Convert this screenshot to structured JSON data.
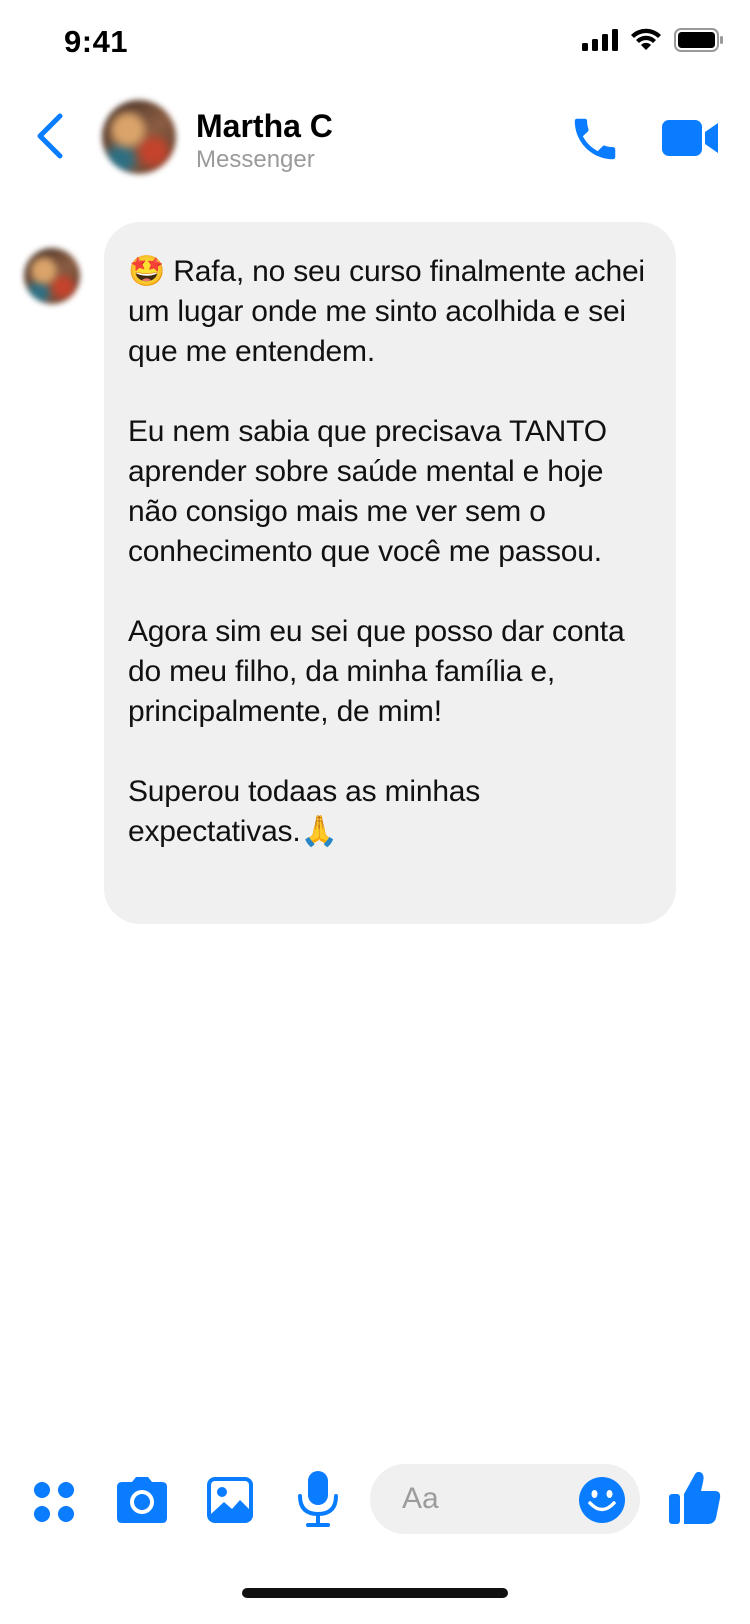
{
  "status_bar": {
    "time": "9:41"
  },
  "header": {
    "contact_name": "Martha C",
    "subtitle": "Messenger"
  },
  "message": {
    "paragraphs": [
      {
        "emoji": "🤩",
        "text": " Rafa, no seu curso finalmente achei um lugar onde me sinto acolhida e sei que me entendem."
      },
      {
        "emoji": "",
        "text": "Eu nem sabia que precisava TANTO aprender sobre saúde mental e hoje não consigo mais me ver sem o conhecimento que você me passou."
      },
      {
        "emoji": "",
        "text": "Agora sim eu sei que posso dar conta do meu filho, da minha família e, principalmente, de mim!"
      },
      {
        "emoji": "🙏",
        "text": "Superou todaas as minhas expectativas."
      }
    ]
  },
  "composer": {
    "placeholder": "Aa"
  },
  "icons": {
    "back": "chevron-left-icon",
    "call": "phone-icon",
    "video": "video-camera-icon",
    "apps": "four-dots-icon",
    "camera": "camera-icon",
    "gallery": "image-icon",
    "mic": "microphone-icon",
    "emoji": "smiley-icon",
    "like": "thumbs-up-icon"
  },
  "colors": {
    "accent": "#0A7CFF",
    "bubble": "#F0F0F0",
    "subtitle": "#9A9A9A"
  }
}
